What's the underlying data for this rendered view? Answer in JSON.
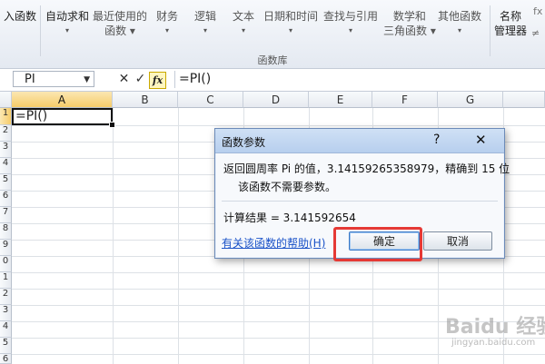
{
  "ribbon": {
    "items": [
      {
        "line1": "入函数",
        "line2": ""
      },
      {
        "line1": "自动求和",
        "line2": "▾"
      },
      {
        "line1": "最近使用的",
        "line2": "函数 ▾"
      },
      {
        "line1": "财务",
        "line2": "▾"
      },
      {
        "line1": "逻辑",
        "line2": "▾"
      },
      {
        "line1": "文本",
        "line2": "▾"
      },
      {
        "line1": "日期和时间",
        "line2": "▾"
      },
      {
        "line1": "查找与引用",
        "line2": "▾"
      },
      {
        "line1": "数学和",
        "line2": "三角函数 ▾"
      },
      {
        "line1": "其他函数",
        "line2": "▾"
      },
      {
        "line1": "名称",
        "line2": "管理器"
      }
    ],
    "group_label": "函数库",
    "corner_top": "fx",
    "corner_bottom": "≠"
  },
  "formula_bar": {
    "name_box": "PI",
    "cancel_glyph": "✕",
    "enter_glyph": "✓",
    "fx_label": "fx",
    "formula": "=PI()"
  },
  "sheet": {
    "columns": [
      "A",
      "B",
      "C",
      "D",
      "E",
      "F",
      "G"
    ],
    "active_cell_text": "=PI()",
    "rows": [
      "1",
      "2",
      "3",
      "4",
      "5",
      "6",
      "7",
      "8",
      "9",
      "0",
      "1",
      "2",
      "3",
      "4",
      "5",
      "6"
    ]
  },
  "dialog": {
    "title": "函数参数",
    "help_glyph": "?",
    "close_glyph": "✕",
    "description": "返回圆周率 Pi 的值，3.14159265358979，精确到 15 位",
    "note": "该函数不需要参数。",
    "result": "计算结果 = 3.141592654",
    "help_link": "有关该函数的帮助(H)",
    "ok_label": "确定",
    "cancel_label": "取消"
  },
  "watermark": {
    "text": "Baidu 经验",
    "url": "jingyan.baidu.com"
  },
  "colors": {
    "highlight": "#e53935",
    "link": "#1a52c8",
    "dialog_title_bg": "#b7cfee"
  }
}
